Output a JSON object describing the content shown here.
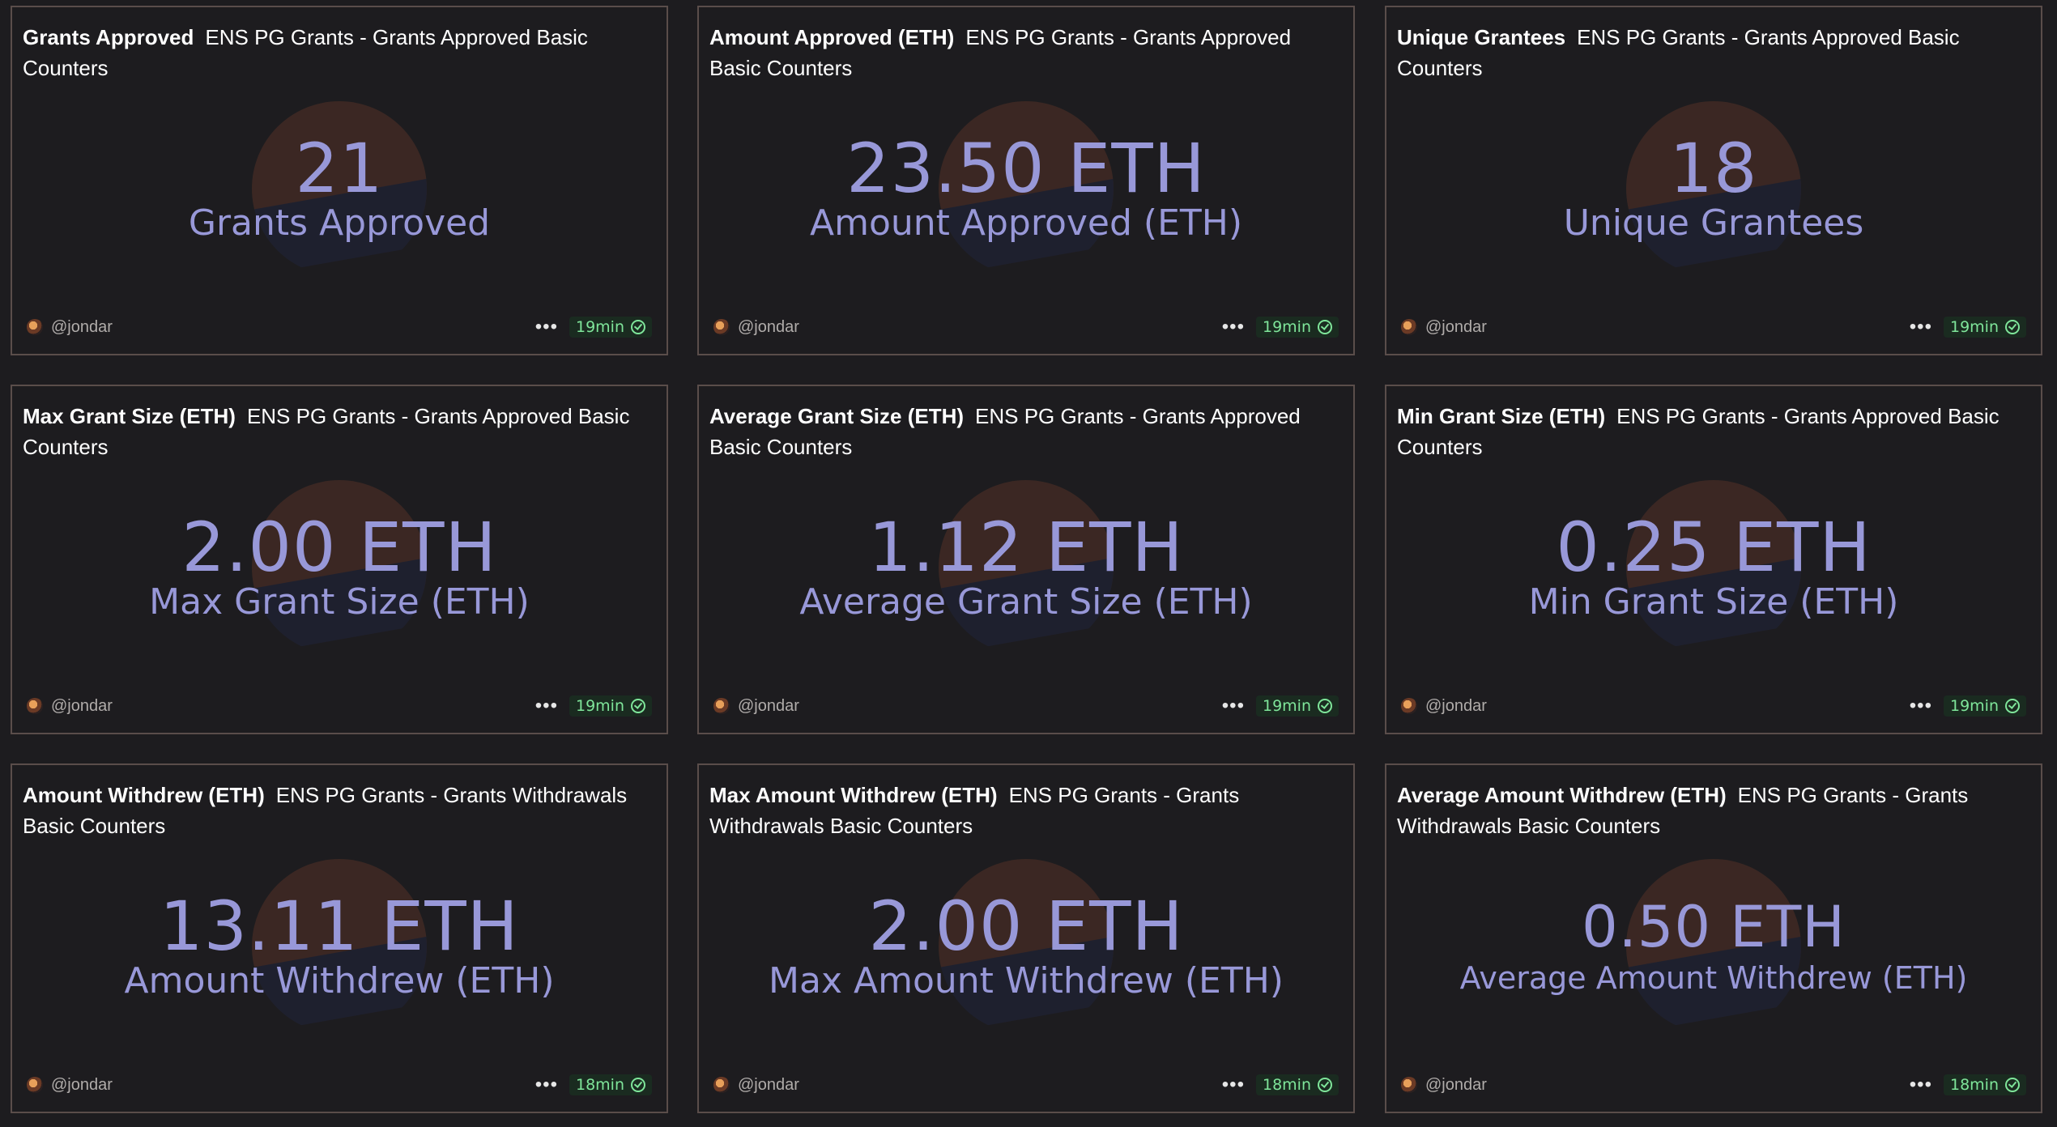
{
  "cards": [
    {
      "title": "Grants Approved",
      "query": "ENS PG Grants - Grants Approved Basic Counters",
      "value": "21",
      "label": "Grants Approved",
      "author": "@jondar",
      "freshness": "19min"
    },
    {
      "title": "Amount Approved (ETH)",
      "query": "ENS PG Grants - Grants Approved Basic Counters",
      "value": "23.50 ETH",
      "label": "Amount Approved (ETH)",
      "author": "@jondar",
      "freshness": "19min"
    },
    {
      "title": "Unique Grantees",
      "query": "ENS PG Grants - Grants Approved Basic Counters",
      "value": "18",
      "label": "Unique Grantees",
      "author": "@jondar",
      "freshness": "19min"
    },
    {
      "title": "Max Grant Size (ETH)",
      "query": "ENS PG Grants - Grants Approved Basic Counters",
      "value": "2.00 ETH",
      "label": "Max Grant Size (ETH)",
      "author": "@jondar",
      "freshness": "19min"
    },
    {
      "title": "Average Grant Size (ETH)",
      "query": "ENS PG Grants - Grants Approved Basic Counters",
      "value": "1.12 ETH",
      "label": "Average Grant Size (ETH)",
      "author": "@jondar",
      "freshness": "19min"
    },
    {
      "title": "Min Grant Size (ETH)",
      "query": "ENS PG Grants - Grants Approved Basic Counters",
      "value": "0.25 ETH",
      "label": "Min Grant Size (ETH)",
      "author": "@jondar",
      "freshness": "19min"
    },
    {
      "title": "Amount Withdrew (ETH)",
      "query": "ENS PG Grants - Grants Withdrawals Basic Counters",
      "value": "13.11 ETH",
      "label": "Amount Withdrew (ETH)",
      "author": "@jondar",
      "freshness": "18min"
    },
    {
      "title": "Max Amount Withdrew (ETH)",
      "query": "ENS PG Grants - Grants Withdrawals Basic Counters",
      "value": "2.00 ETH",
      "label": "Max Amount Withdrew (ETH)",
      "author": "@jondar",
      "freshness": "18min"
    },
    {
      "title": "Average Amount Withdrew (ETH)",
      "query": "ENS PG Grants - Grants Withdrawals Basic Counters",
      "value": "0.50 ETH",
      "label": "Average Amount Withdrew (ETH)",
      "author": "@jondar",
      "freshness": "18min"
    }
  ],
  "colors": {
    "background": "#1d1c1f",
    "card_border": "#5a4d4a",
    "counter_text": "#9898d8",
    "freshness_text": "#7fe59a",
    "freshness_bg": "#1a2b20"
  }
}
